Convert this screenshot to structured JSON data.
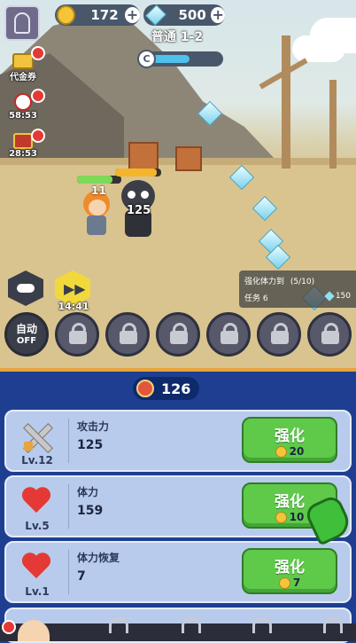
{
  "hud": {
    "coins": "172",
    "gems": "500",
    "stage": "普通 1-2",
    "stage_progress": 0.55
  },
  "side": {
    "voucher_label": "代金券",
    "timer1": "58:53",
    "timer2": "28:53"
  },
  "battle": {
    "hero_level": "11",
    "enemy_hp": "125"
  },
  "controls": {
    "pause_icon": "minus-icon",
    "speed_timer": "14:41",
    "auto_label": "自动",
    "auto_state": "OFF"
  },
  "quest": {
    "title": "强化体力到",
    "progress": "(5/10)",
    "task": "任务 6",
    "reward": "150"
  },
  "panel": {
    "total": "126",
    "rows": [
      {
        "name": "攻击力",
        "value": "125",
        "level": "Lv.12",
        "button": "强化",
        "cost": "20"
      },
      {
        "name": "体力",
        "value": "159",
        "level": "Lv.5",
        "button": "强化",
        "cost": "10"
      },
      {
        "name": "体力恢复",
        "value": "7",
        "level": "Lv.1",
        "button": "强化",
        "cost": "7"
      }
    ]
  },
  "colors": {
    "accent_green": "#5fc94a",
    "panel_blue": "#1e3f91"
  }
}
